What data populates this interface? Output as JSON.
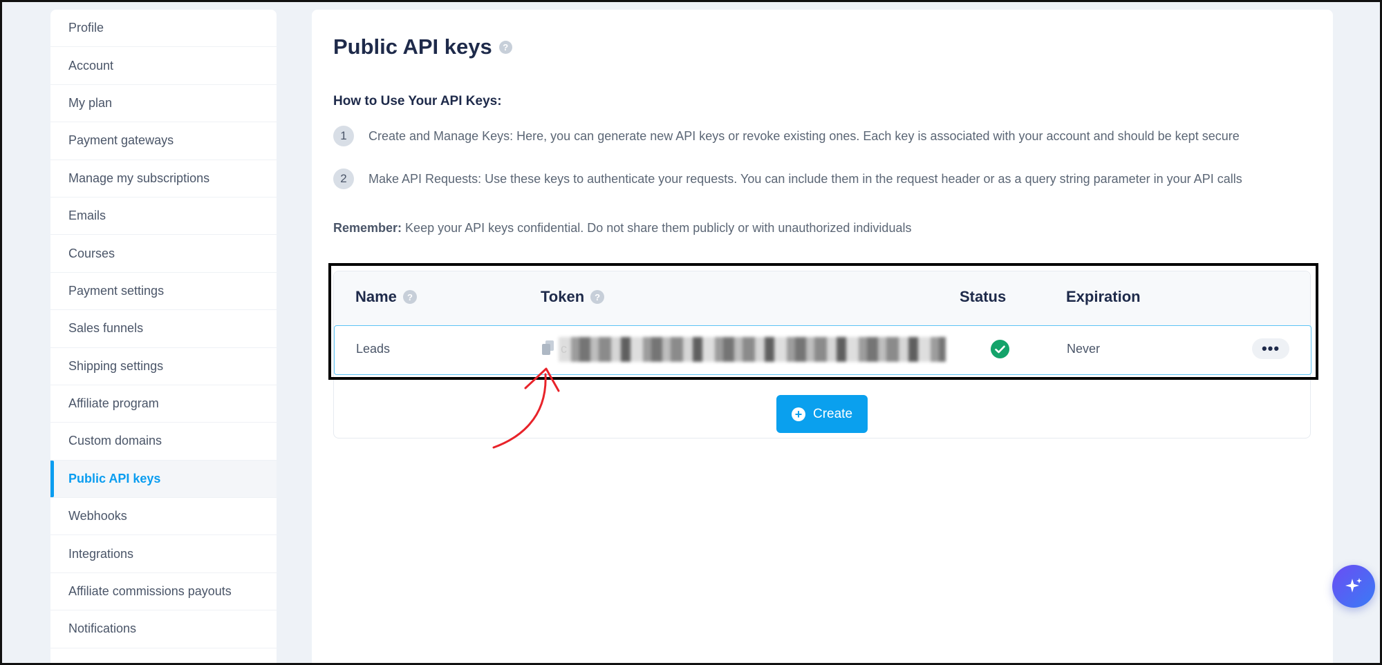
{
  "sidebar": {
    "items": [
      {
        "label": "Profile"
      },
      {
        "label": "Account"
      },
      {
        "label": "My plan"
      },
      {
        "label": "Payment gateways"
      },
      {
        "label": "Manage my subscriptions"
      },
      {
        "label": "Emails"
      },
      {
        "label": "Courses"
      },
      {
        "label": "Payment settings"
      },
      {
        "label": "Sales funnels"
      },
      {
        "label": "Shipping settings"
      },
      {
        "label": "Affiliate program"
      },
      {
        "label": "Custom domains"
      },
      {
        "label": "Public API keys",
        "active": true
      },
      {
        "label": "Webhooks"
      },
      {
        "label": "Integrations"
      },
      {
        "label": "Affiliate commissions payouts"
      },
      {
        "label": "Notifications"
      }
    ]
  },
  "main": {
    "title": "Public API keys",
    "howto_heading": "How to Use Your API Keys:",
    "steps": [
      {
        "num": "1",
        "text": "Create and Manage Keys: Here, you can generate new API keys or revoke existing ones. Each key is associated with your account and should be kept secure"
      },
      {
        "num": "2",
        "text": "Make API Requests: Use these keys to authenticate your requests. You can include them in the request header or as a query string parameter in your API calls"
      }
    ],
    "remember_label": "Remember:",
    "remember_text": " Keep your API keys confidential. Do not share them publicly or with unauthorized individuals"
  },
  "table": {
    "headers": {
      "name": "Name",
      "token": "Token",
      "status": "Status",
      "expiration": "Expiration"
    },
    "rows": [
      {
        "name": "Leads",
        "token_prefix": "c",
        "status": "active",
        "expiration": "Never"
      }
    ],
    "more_label": "•••",
    "create_label": "Create"
  },
  "colors": {
    "accent": "#0aa0ee",
    "status_ok": "#14a36a",
    "annotation": "#e8232a"
  }
}
